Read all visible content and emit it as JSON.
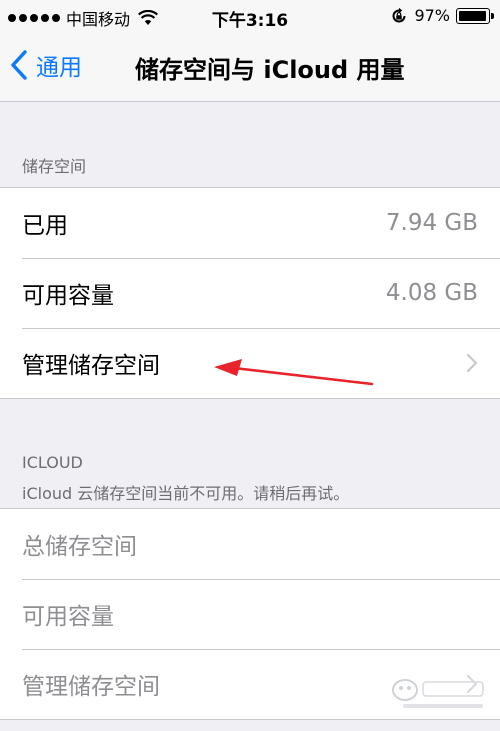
{
  "status_bar": {
    "carrier": "中国移动",
    "time": "下午3:16",
    "battery_text": "97%",
    "battery_level": 0.97
  },
  "nav": {
    "back_label": "通用",
    "title": "储存空间与 iCloud 用量",
    "accent_color": "#0a7aff"
  },
  "storage": {
    "header": "储存空间",
    "rows": [
      {
        "label": "已用",
        "value": "7.94 GB"
      },
      {
        "label": "可用容量",
        "value": "4.08 GB"
      },
      {
        "label": "管理储存空间"
      }
    ]
  },
  "icloud": {
    "header": "ICLOUD",
    "message": "iCloud 云储存空间当前不可用。请稍后再试。",
    "rows": [
      {
        "label": "总储存空间"
      },
      {
        "label": "可用容量"
      },
      {
        "label": "管理储存空间"
      }
    ]
  },
  "icons": [
    "wifi-icon",
    "rotation-lock-icon",
    "battery-icon",
    "back-chevron-icon",
    "chevron-right-icon",
    "red-arrow-icon"
  ]
}
